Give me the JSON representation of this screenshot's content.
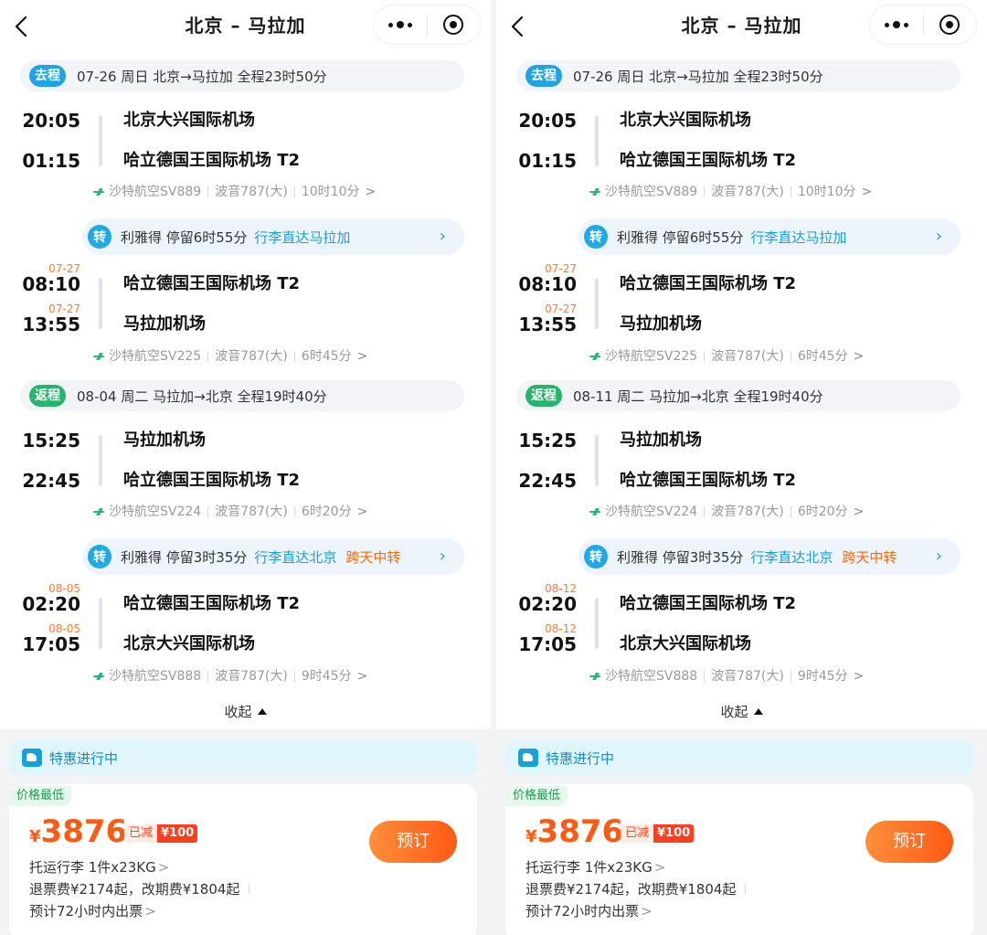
{
  "header": {
    "title": "北京 – 马拉加"
  },
  "panels": [
    {
      "outbound": {
        "tag": "去程",
        "summary": "07-26 周日  北京→马拉加  全程23时50分",
        "seg1": {
          "dep_time": "20:05",
          "dep_airport": "北京大兴国际机场",
          "arr_time": "01:15",
          "arr_airport": "哈立德国王国际机场 T2",
          "airline": "沙特航空SV889",
          "aircraft": "波音787(大)",
          "duration": "10时10分"
        },
        "transfer": {
          "badge": "转",
          "text": "利雅得 停留6时55分",
          "note": "行李直达马拉加",
          "extra": ""
        },
        "seg2": {
          "dep_date": "07-27",
          "dep_time": "08:10",
          "dep_airport": "哈立德国王国际机场 T2",
          "arr_date": "07-27",
          "arr_time": "13:55",
          "arr_airport": "马拉加机场",
          "airline": "沙特航空SV225",
          "aircraft": "波音787(大)",
          "duration": "6时45分"
        }
      },
      "inbound": {
        "tag": "返程",
        "summary": "08-04 周二  马拉加→北京  全程19时40分",
        "seg1": {
          "dep_time": "15:25",
          "dep_airport": "马拉加机场",
          "arr_time": "22:45",
          "arr_airport": "哈立德国王国际机场 T2",
          "airline": "沙特航空SV224",
          "aircraft": "波音787(大)",
          "duration": "6时20分"
        },
        "transfer": {
          "badge": "转",
          "text": "利雅得 停留3时35分",
          "note": "行李直达北京",
          "extra": "跨天中转"
        },
        "seg2": {
          "dep_date": "08-05",
          "dep_time": "02:20",
          "dep_airport": "哈立德国王国际机场 T2",
          "arr_date": "08-05",
          "arr_time": "17:05",
          "arr_airport": "北京大兴国际机场",
          "airline": "沙特航空SV888",
          "aircraft": "波音787(大)",
          "duration": "9时45分"
        }
      }
    },
    {
      "outbound": {
        "tag": "去程",
        "summary": "07-26 周日  北京→马拉加  全程23时50分",
        "seg1": {
          "dep_time": "20:05",
          "dep_airport": "北京大兴国际机场",
          "arr_time": "01:15",
          "arr_airport": "哈立德国王国际机场 T2",
          "airline": "沙特航空SV889",
          "aircraft": "波音787(大)",
          "duration": "10时10分"
        },
        "transfer": {
          "badge": "转",
          "text": "利雅得 停留6时55分",
          "note": "行李直达马拉加",
          "extra": ""
        },
        "seg2": {
          "dep_date": "07-27",
          "dep_time": "08:10",
          "dep_airport": "哈立德国王国际机场 T2",
          "arr_date": "07-27",
          "arr_time": "13:55",
          "arr_airport": "马拉加机场",
          "airline": "沙特航空SV225",
          "aircraft": "波音787(大)",
          "duration": "6时45分"
        }
      },
      "inbound": {
        "tag": "返程",
        "summary": "08-11 周二  马拉加→北京  全程19时40分",
        "seg1": {
          "dep_time": "15:25",
          "dep_airport": "马拉加机场",
          "arr_time": "22:45",
          "arr_airport": "哈立德国王国际机场 T2",
          "airline": "沙特航空SV224",
          "aircraft": "波音787(大)",
          "duration": "6时20分"
        },
        "transfer": {
          "badge": "转",
          "text": "利雅得 停留3时35分",
          "note": "行李直达北京",
          "extra": "跨天中转"
        },
        "seg2": {
          "dep_date": "08-12",
          "dep_time": "02:20",
          "dep_airport": "哈立德国王国际机场 T2",
          "arr_date": "08-12",
          "arr_time": "17:05",
          "arr_airport": "北京大兴国际机场",
          "airline": "沙特航空SV888",
          "aircraft": "波音787(大)",
          "duration": "9时45分"
        }
      }
    }
  ],
  "collapse_label": "收起",
  "promo": {
    "text": "特惠进行中",
    "icon": "camel-icon"
  },
  "price_card": {
    "tag": "价格最低",
    "currency": "¥",
    "price": "3876",
    "discount_label": "已减",
    "discount_amount": "¥100",
    "book_label": "预订",
    "baggage": "托运行李 1件x23KG",
    "refund": "退票费¥2174起，改期费¥1804起",
    "ticketing": "预计72小时内出票"
  },
  "colors": {
    "accent": "#1fa3e6",
    "return": "#27b46c",
    "price": "#ff5a13",
    "orange": "#ff6a00"
  }
}
